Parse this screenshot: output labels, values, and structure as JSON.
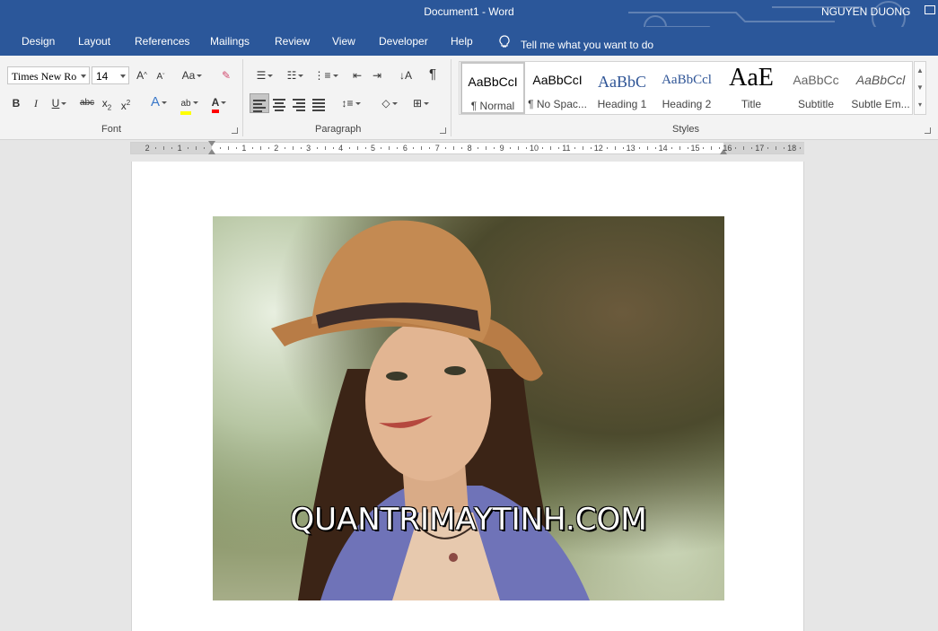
{
  "window": {
    "doc_title": "Document1  -  Word",
    "user_name": "NGUYEN DUONG"
  },
  "tabs": [
    "Design",
    "Layout",
    "References",
    "Mailings",
    "Review",
    "View",
    "Developer",
    "Help"
  ],
  "tell_me": "Tell me what you want to do",
  "font_group": {
    "font_name": "Times New Ro",
    "font_size": "14",
    "label": "Font"
  },
  "paragraph_group": {
    "label": "Paragraph"
  },
  "styles_group": {
    "label": "Styles",
    "items": [
      {
        "preview": "AaBbCcI",
        "name": "¶ Normal"
      },
      {
        "preview": "AaBbCcI",
        "name": "¶ No Spac..."
      },
      {
        "preview": "AaBbC",
        "name": "Heading 1"
      },
      {
        "preview": "AaBbCcl",
        "name": "Heading 2"
      },
      {
        "preview": "AaE",
        "name": "Title"
      },
      {
        "preview": "AaBbCc",
        "name": "Subtitle"
      },
      {
        "preview": "AaBbCcl",
        "name": "Subtle Em..."
      }
    ]
  },
  "ruler": {
    "left_numbers": [
      "2",
      "1"
    ],
    "numbers": [
      "1",
      "2",
      "3",
      "4",
      "5",
      "6",
      "7",
      "8",
      "9",
      "10",
      "11",
      "12",
      "13",
      "14",
      "15",
      "16",
      "17",
      "18"
    ]
  },
  "document": {
    "image_watermark": "QUANTRIMAYTINH.COM"
  },
  "colors": {
    "title_bar": "#2b579a",
    "ribbon": "#f3f3f3",
    "highlight_yellow": "#ffff00",
    "font_color_red": "#ff0000"
  }
}
